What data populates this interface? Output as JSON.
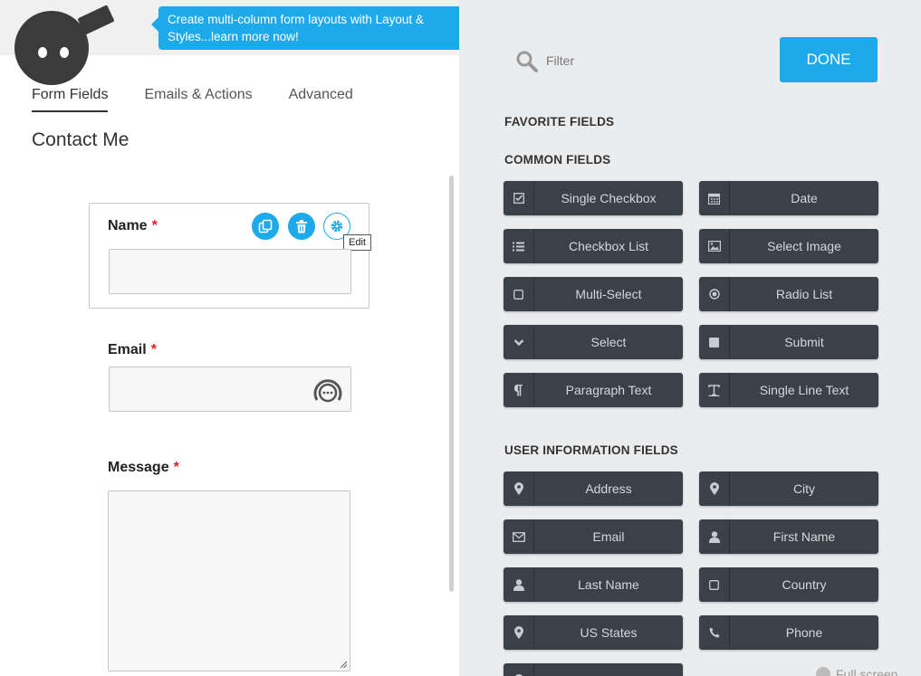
{
  "banner": {
    "text": "Create multi-column form layouts with Layout & Styles...learn more now!"
  },
  "tabs": [
    {
      "label": "Form Fields",
      "active": true
    },
    {
      "label": "Emails & Actions",
      "active": false
    },
    {
      "label": "Advanced",
      "active": false
    }
  ],
  "form": {
    "title": "Contact Me",
    "fields": [
      {
        "label": "Name",
        "required": "*"
      },
      {
        "label": "Email",
        "required": "*"
      },
      {
        "label": "Message",
        "required": "*"
      }
    ],
    "tooltip": "Edit"
  },
  "sidebar": {
    "filter_placeholder": "Filter",
    "done_label": "DONE",
    "favorite_heading": "FAVORITE FIELDS",
    "common_heading": "COMMON FIELDS",
    "common_fields": [
      {
        "label": "Single Checkbox",
        "icon": "checkbox-icon"
      },
      {
        "label": "Date",
        "icon": "calendar-icon"
      },
      {
        "label": "Checkbox List",
        "icon": "list-icon"
      },
      {
        "label": "Select Image",
        "icon": "image-icon"
      },
      {
        "label": "Multi-Select",
        "icon": "square-icon"
      },
      {
        "label": "Radio List",
        "icon": "radio-icon"
      },
      {
        "label": "Select",
        "icon": "chevron-down-icon"
      },
      {
        "label": "Submit",
        "icon": "submit-square-icon"
      },
      {
        "label": "Paragraph Text",
        "icon": "paragraph-icon"
      },
      {
        "label": "Single Line Text",
        "icon": "text-icon"
      }
    ],
    "user_heading": "USER INFORMATION FIELDS",
    "user_fields": [
      {
        "label": "Address",
        "icon": "map-pin-icon"
      },
      {
        "label": "City",
        "icon": "map-pin-icon"
      },
      {
        "label": "Email",
        "icon": "envelope-icon"
      },
      {
        "label": "First Name",
        "icon": "user-icon"
      },
      {
        "label": "Last Name",
        "icon": "user-icon"
      },
      {
        "label": "Country",
        "icon": "square-icon"
      },
      {
        "label": "US States",
        "icon": "map-pin-icon"
      },
      {
        "label": "Phone",
        "icon": "phone-icon"
      }
    ],
    "fullscreen_label": "Full screen"
  },
  "colors": {
    "accent": "#1ea9ea",
    "button_dark": "#3b4149",
    "required": "#d9262b"
  }
}
